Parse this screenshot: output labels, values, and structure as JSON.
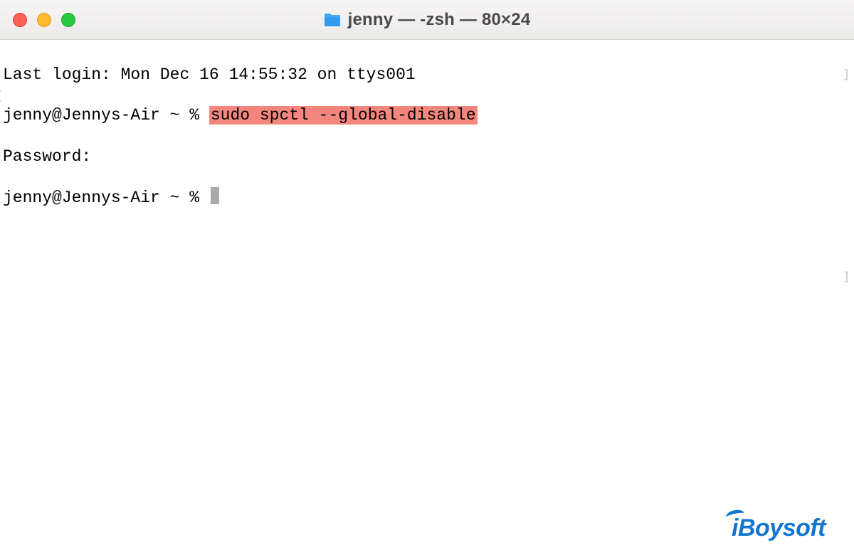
{
  "titlebar": {
    "folder_icon": "folder-icon",
    "title": "jenny — -zsh — 80×24"
  },
  "terminal": {
    "last_login": "Last login: Mon Dec 16 14:55:32 on ttys001",
    "prompt1_prefix": "jenny@Jennys-Air ~ % ",
    "command_highlighted": "sudo spctl --global-disable",
    "password_prompt": "Password:",
    "prompt2_prefix": "jenny@Jennys-Air ~ % "
  },
  "watermark": {
    "text": "iBoysoft"
  },
  "colors": {
    "highlight_bg": "#f5867d",
    "traffic_close": "#fe5f57",
    "traffic_min": "#febb2e",
    "traffic_max": "#28c840",
    "brand": "#1176d0"
  }
}
